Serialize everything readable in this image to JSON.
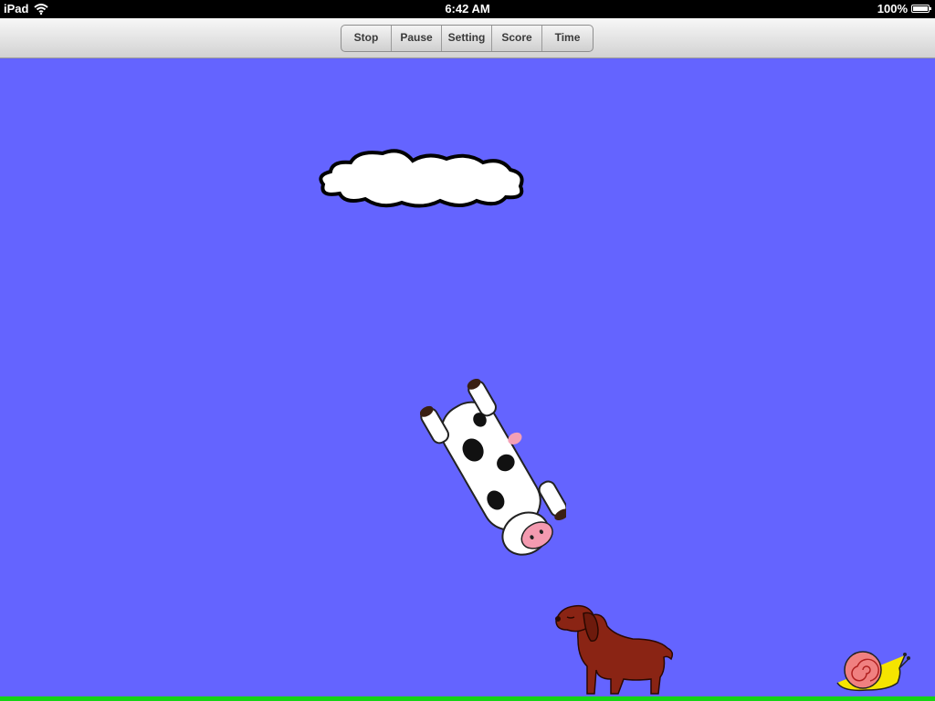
{
  "status": {
    "device": "iPad",
    "time": "6:42 AM",
    "battery": "100%",
    "battery_level": 1.0,
    "icons": [
      "wifi-icon",
      "battery-icon"
    ]
  },
  "toolbar": {
    "buttons": [
      {
        "label": "Stop"
      },
      {
        "label": "Pause"
      },
      {
        "label": "Setting"
      },
      {
        "label": "Score"
      },
      {
        "label": "Time"
      }
    ]
  },
  "scene": {
    "sky_color": "#6464ff",
    "ground_color": "#14d414",
    "sprites": [
      "cloud",
      "cow",
      "dog",
      "snail"
    ]
  }
}
